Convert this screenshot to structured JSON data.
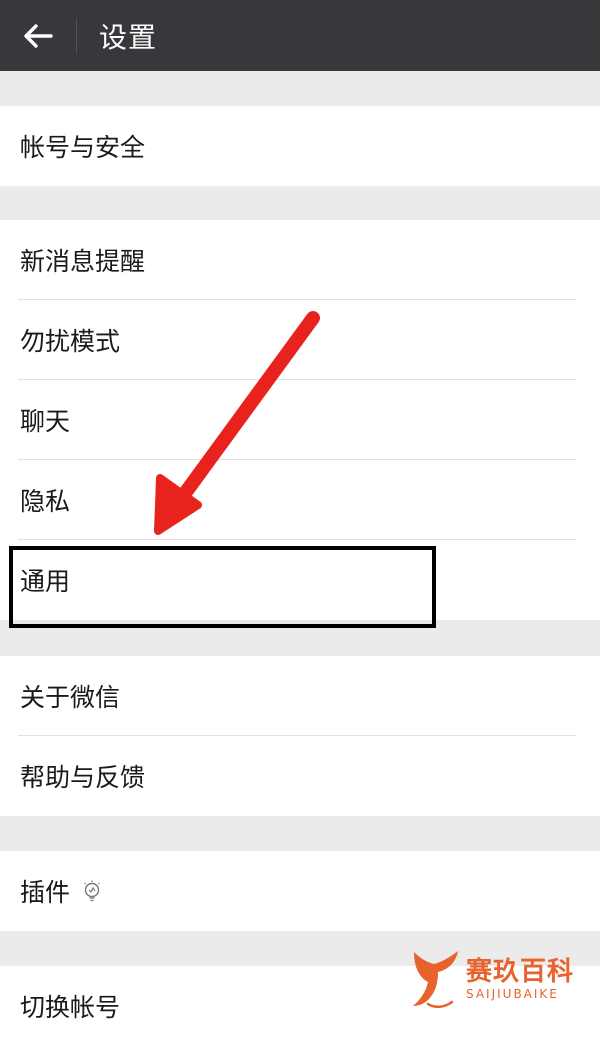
{
  "header": {
    "title": "设置"
  },
  "groups": [
    {
      "items": [
        {
          "label": "帐号与安全"
        }
      ]
    },
    {
      "items": [
        {
          "label": "新消息提醒"
        },
        {
          "label": "勿扰模式"
        },
        {
          "label": "聊天"
        },
        {
          "label": "隐私"
        },
        {
          "label": "通用"
        }
      ]
    },
    {
      "items": [
        {
          "label": "关于微信"
        },
        {
          "label": "帮助与反馈"
        }
      ]
    },
    {
      "items": [
        {
          "label": "插件",
          "icon": "lightbulb-icon"
        }
      ]
    },
    {
      "items": [
        {
          "label": "切换帐号"
        }
      ]
    }
  ],
  "watermark": {
    "cn": "赛玖百科",
    "en": "SAIJIUBAIKE"
  },
  "colors": {
    "topbar": "#38383c",
    "background": "#ebebeb",
    "annotation_arrow": "#e8231e",
    "watermark": "#e8622b"
  }
}
